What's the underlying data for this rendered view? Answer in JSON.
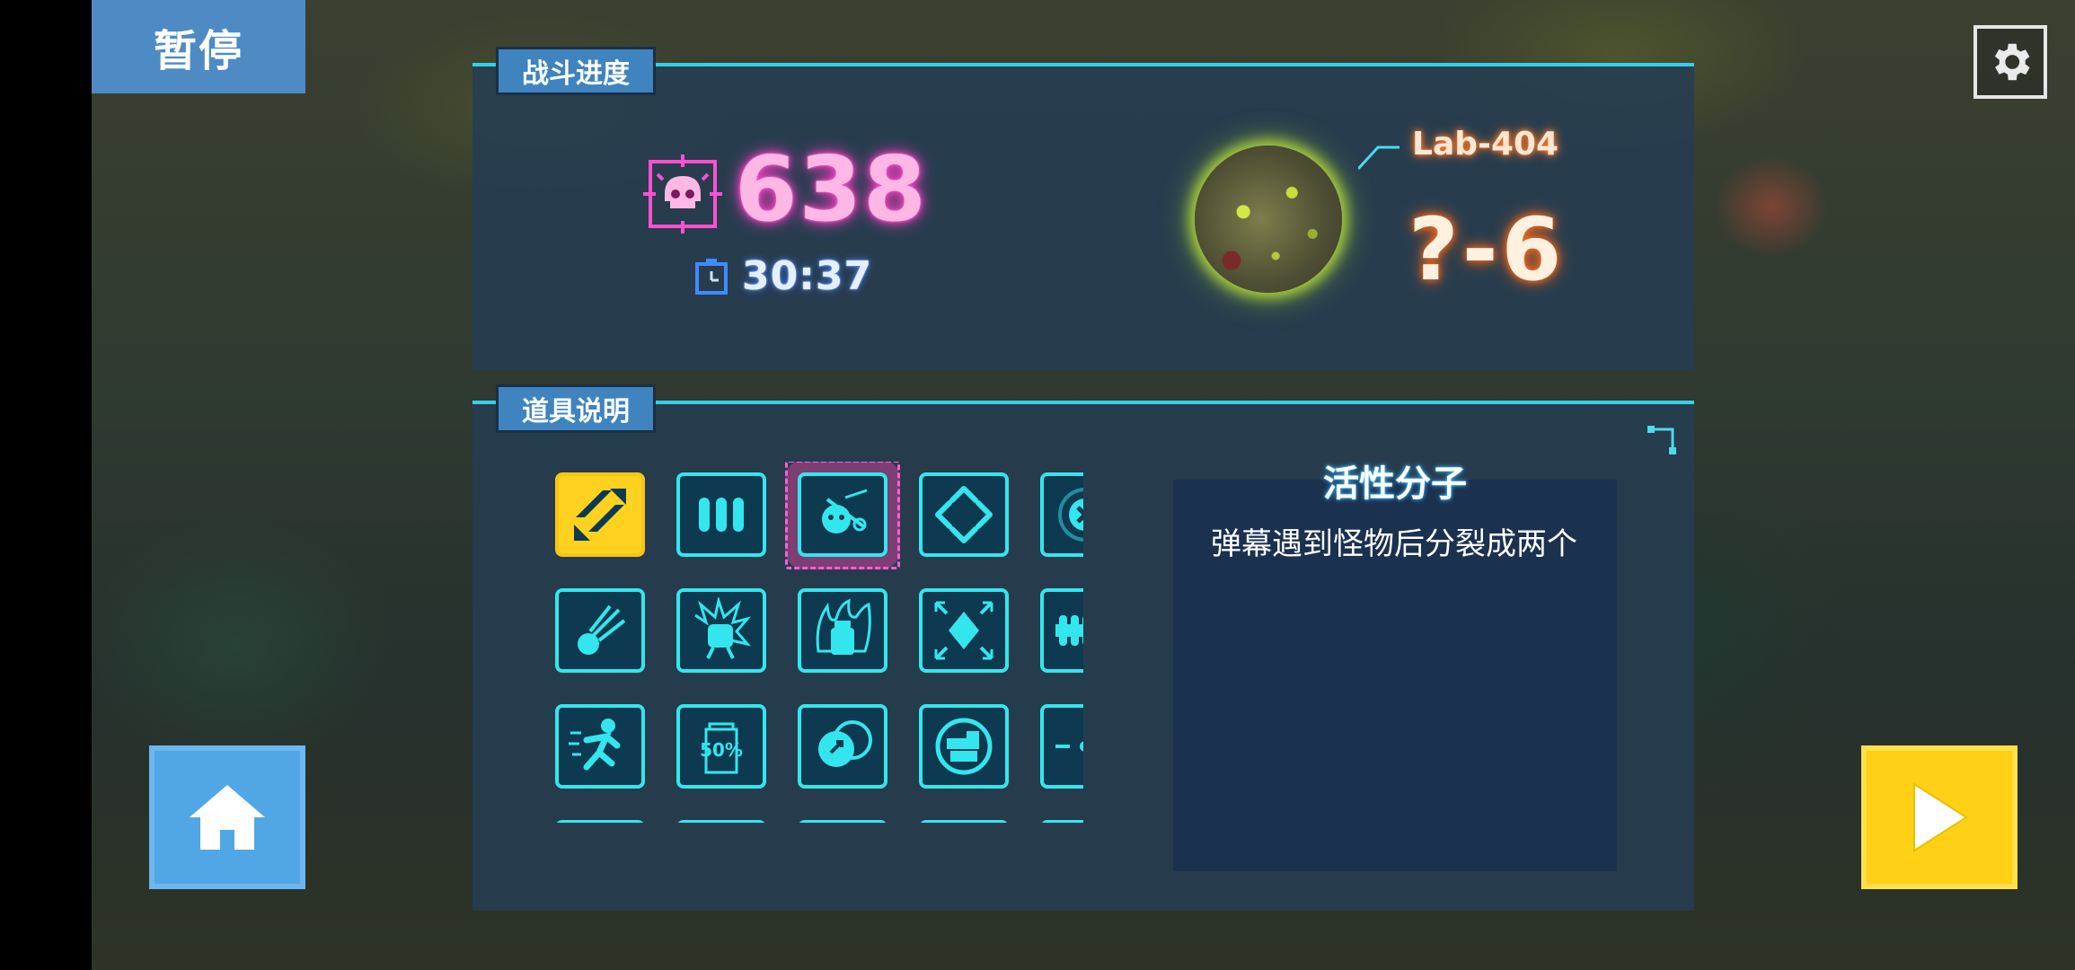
{
  "pause_label": "暂停",
  "battle_progress": {
    "tab_label": "战斗进度",
    "kill_count": "638",
    "time": "30:37",
    "location": "Lab-404",
    "stage": "?-6"
  },
  "item_info": {
    "tab_label": "道具说明",
    "selected_name": "活性分子",
    "selected_description": "弹幕遇到怪物后分裂成两个",
    "items": [
      {
        "icon": "arrows-icon",
        "state": "active"
      },
      {
        "icon": "triple-bullet-icon"
      },
      {
        "icon": "active-molecule-icon",
        "state": "selected"
      },
      {
        "icon": "diamond-arrows-icon"
      },
      {
        "icon": "cancel-circle-icon"
      },
      {
        "icon": "comet-icon"
      },
      {
        "icon": "punch-icon"
      },
      {
        "icon": "potion-flame-icon"
      },
      {
        "icon": "expand-crystal-icon"
      },
      {
        "icon": "ammo-belt-icon"
      },
      {
        "icon": "sprint-icon"
      },
      {
        "icon": "fifty-percent-icon"
      },
      {
        "icon": "split-orbs-icon"
      },
      {
        "icon": "turret-circle-icon"
      },
      {
        "icon": "target-spread-icon"
      },
      {
        "icon": "rocket-icon"
      },
      {
        "icon": "radar-icon"
      },
      {
        "icon": "web-icon"
      },
      {
        "icon": "triple-bullet-icon"
      },
      {
        "icon": "rocket-icon"
      }
    ],
    "items_badge": "50%"
  },
  "colors": {
    "accent_cyan": "#33e6ee",
    "kill_pink": "#ff3fc8",
    "stage_orange": "#ff6a1a",
    "play_yellow": "#ffd015",
    "home_blue": "#51a7e6"
  }
}
